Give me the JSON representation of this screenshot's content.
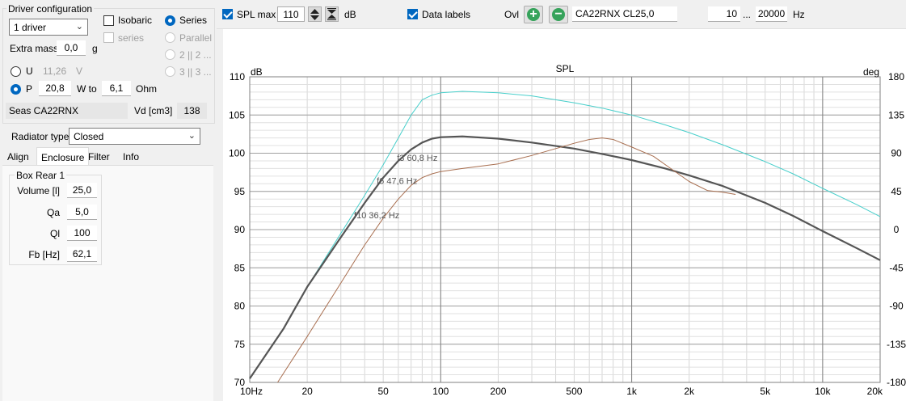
{
  "driver_config": {
    "title": "Driver configuration",
    "drivers_select": "1 driver",
    "isobaric_label": "Isobaric",
    "series_sub_label": "series",
    "series_label": "Series",
    "parallel_label": "Parallel",
    "opt_2x2_label": "2 || 2 ...",
    "opt_3x3_label": "3 || 3 ...",
    "extra_mass_label": "Extra mass",
    "extra_mass_value": "0,0",
    "extra_mass_unit": "g",
    "u_label": "U",
    "u_value": "11,26",
    "u_unit": "V",
    "p_label": "P",
    "p_value": "20,8",
    "w_to_label": "W to",
    "ohm_value": "6,1",
    "ohm_unit": "Ohm",
    "driver_name": "Seas CA22RNX",
    "vd_label": "Vd [cm3]",
    "vd_value": "138"
  },
  "radiator": {
    "label": "Radiator type",
    "value": "Closed"
  },
  "tabs": [
    "Align",
    "Enclosure",
    "Filter",
    "Info"
  ],
  "box": {
    "title": "Box Rear 1",
    "fields": [
      {
        "label": "Volume [l]",
        "value": "25,0"
      },
      {
        "label": "Qa",
        "value": "5,0"
      },
      {
        "label": "Ql",
        "value": "100"
      },
      {
        "label": "Fb [Hz]",
        "value": "62,1"
      }
    ]
  },
  "toolbar": {
    "spl_max_label": "SPL max",
    "spl_max_value": "110",
    "db_unit": "dB",
    "data_labels_label": "Data labels",
    "ovl_label": "Ovl",
    "overlay_name": "CA22RNX CL25,0",
    "freq_from": "10",
    "freq_sep": "...",
    "freq_to": "20000",
    "hz_unit": "Hz"
  },
  "chart_data": {
    "type": "line",
    "title": "SPL",
    "ylabel_left": "dB",
    "ylabel_right": "deg",
    "xscale": "log",
    "xlim": [
      10,
      20000
    ],
    "ylim": [
      70,
      110
    ],
    "ylim_right": [
      -180,
      180
    ],
    "x_ticks": [
      {
        "v": 10,
        "t": "10Hz"
      },
      {
        "v": 20,
        "t": "20"
      },
      {
        "v": 50,
        "t": "50"
      },
      {
        "v": 100,
        "t": "100"
      },
      {
        "v": 200,
        "t": "200"
      },
      {
        "v": 500,
        "t": "500"
      },
      {
        "v": 1000,
        "t": "1k"
      },
      {
        "v": 2000,
        "t": "2k"
      },
      {
        "v": 5000,
        "t": "5k"
      },
      {
        "v": 10000,
        "t": "10k"
      },
      {
        "v": 20000,
        "t": "20k"
      }
    ],
    "y_ticks": [
      110,
      105,
      100,
      95,
      90,
      85,
      80,
      75,
      70
    ],
    "y_right_ticks": [
      180,
      135,
      90,
      45,
      0,
      -45,
      -90,
      -135,
      -180
    ],
    "grid": true,
    "series": [
      {
        "color": "#48cfcb",
        "width": 1,
        "x": [
          10,
          15,
          20,
          30,
          40,
          50,
          60,
          70,
          80,
          90,
          100,
          130,
          200,
          300,
          500,
          700,
          1000,
          1500,
          2000,
          3000,
          5000,
          7000,
          10000,
          15000,
          20000
        ],
        "y": [
          70.5,
          77,
          82.5,
          89.5,
          94.5,
          98.5,
          102,
          105,
          107,
          107.6,
          107.9,
          108.1,
          107.9,
          107.5,
          106.6,
          105.9,
          105,
          103.7,
          102.7,
          101.1,
          98.9,
          97.3,
          95.4,
          93.3,
          91.7
        ]
      },
      {
        "color": "#555555",
        "width": 2.2,
        "x": [
          10,
          15,
          20,
          30,
          40,
          50,
          60,
          70,
          80,
          90,
          100,
          130,
          200,
          300,
          500,
          700,
          1000,
          1500,
          2000,
          3000,
          5000,
          7000,
          10000,
          15000,
          20000
        ],
        "y": [
          70.5,
          77,
          82.5,
          89,
          93.5,
          96.8,
          99,
          100.5,
          101.4,
          101.9,
          102.1,
          102.2,
          101.9,
          101.4,
          100.6,
          99.9,
          99.1,
          98,
          97.1,
          95.7,
          93.5,
          91.8,
          89.8,
          87.6,
          86
        ]
      },
      {
        "color": "#a86e4f",
        "width": 1,
        "x": [
          14,
          20,
          30,
          40,
          50,
          60,
          70,
          80,
          90,
          100,
          130,
          200,
          300,
          400,
          500,
          600,
          700,
          800,
          1000,
          1300,
          1600,
          2000,
          2500,
          3000,
          3500
        ],
        "y": [
          70,
          76,
          83,
          88,
          91.5,
          94,
          95.8,
          96.8,
          97.3,
          97.6,
          98,
          98.6,
          99.7,
          100.6,
          101.3,
          101.8,
          102,
          101.8,
          100.8,
          99.6,
          98,
          96.3,
          95.1,
          94.9,
          94.6
        ]
      }
    ],
    "annotations": [
      {
        "text": "f3 60,8 Hz",
        "x": 60.8,
        "y": 99
      },
      {
        "text": "f6 47,6 Hz",
        "x": 47.6,
        "y": 96
      },
      {
        "text": "f10 36,2 Hz",
        "x": 36.2,
        "y": 91.5
      }
    ]
  }
}
